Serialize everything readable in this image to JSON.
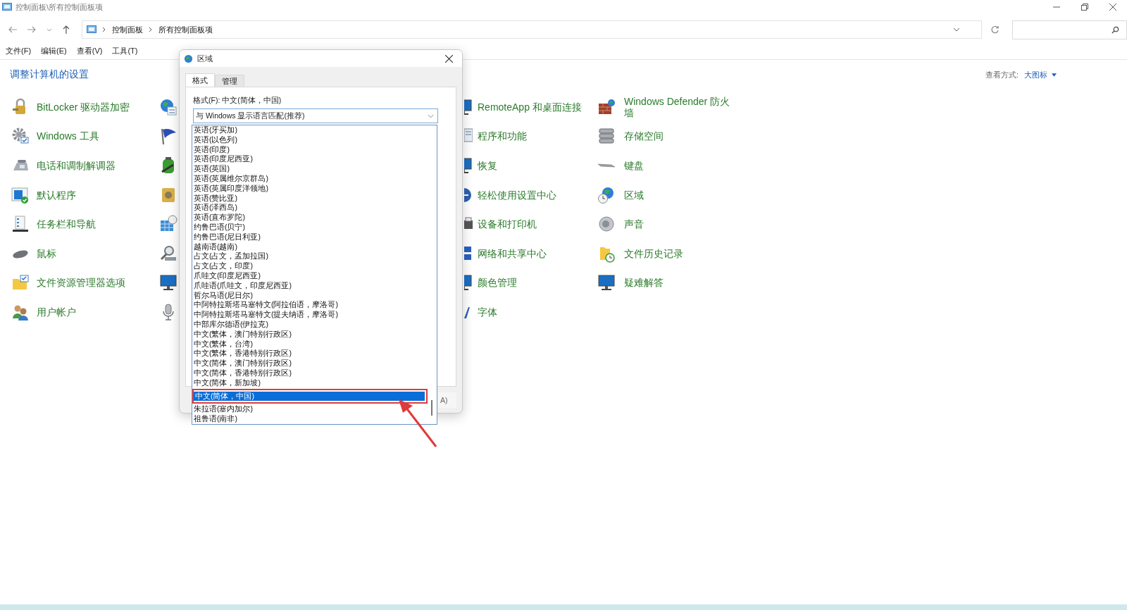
{
  "window": {
    "title": "控制面板\\所有控制面板项"
  },
  "address_bar": {
    "breadcrumbs": [
      "控制面板",
      "所有控制面板项"
    ]
  },
  "menu": [
    "文件(F)",
    "编辑(E)",
    "查看(V)",
    "工具(T)"
  ],
  "heading": "调整计算机的设置",
  "view_by": {
    "label": "查看方式:",
    "value": "大图标"
  },
  "grid": [
    {
      "cells": [
        {
          "kind": "labeled",
          "label": "BitLocker 驱动器加密"
        },
        {
          "kind": "covered"
        },
        {
          "kind": "labeled",
          "label": "RemoteApp 和桌面连接"
        },
        {
          "kind": "labeled",
          "label": "Windows Defender 防火墙"
        }
      ]
    },
    {
      "cells": [
        {
          "kind": "labeled",
          "label": "Windows 工具"
        },
        {
          "kind": "covered"
        },
        {
          "kind": "labeled",
          "label": "程序和功能"
        },
        {
          "kind": "labeled",
          "label": "存储空间"
        }
      ]
    },
    {
      "cells": [
        {
          "kind": "labeled",
          "label": "电话和调制解调器"
        },
        {
          "kind": "covered"
        },
        {
          "kind": "labeled",
          "label": "恢复"
        },
        {
          "kind": "labeled",
          "label": "键盘"
        }
      ]
    },
    {
      "cells": [
        {
          "kind": "labeled",
          "label": "默认程序"
        },
        {
          "kind": "covered"
        },
        {
          "kind": "labeled",
          "label": "轻松使用设置中心"
        },
        {
          "kind": "labeled",
          "label": "区域"
        }
      ]
    },
    {
      "cells": [
        {
          "kind": "labeled",
          "label": "任务栏和导航"
        },
        {
          "kind": "covered"
        },
        {
          "kind": "labeled",
          "label": "设备和打印机"
        },
        {
          "kind": "labeled",
          "label": "声音"
        }
      ]
    },
    {
      "cells": [
        {
          "kind": "labeled",
          "label": "鼠标"
        },
        {
          "kind": "covered"
        },
        {
          "kind": "labeled",
          "label": "网络和共享中心"
        },
        {
          "kind": "labeled",
          "label": "文件历史记录"
        }
      ]
    },
    {
      "cells": [
        {
          "kind": "labeled",
          "label": "文件资源管理器选项"
        },
        {
          "kind": "covered"
        },
        {
          "kind": "labeled",
          "label": "颜色管理"
        },
        {
          "kind": "labeled",
          "label": "疑难解答"
        }
      ]
    },
    {
      "cells": [
        {
          "kind": "labeled",
          "label": "用户帐户"
        },
        {
          "kind": "covered"
        },
        {
          "kind": "labeled",
          "label": "字体"
        }
      ]
    }
  ],
  "dialog": {
    "title": "区域",
    "tabs": [
      {
        "label": "格式",
        "selected": true
      },
      {
        "label": "管理",
        "selected": false
      }
    ],
    "format_label": "格式(F): 中文(简体，中国)",
    "format_value": "与 Windows 显示语言匹配(推荐)",
    "button_fragment": "A)",
    "options": [
      {
        "label": "英语(牙买加)",
        "selected": false
      },
      {
        "label": "英语(以色列)",
        "selected": false
      },
      {
        "label": "英语(印度)",
        "selected": false
      },
      {
        "label": "英语(印度尼西亚)",
        "selected": false
      },
      {
        "label": "英语(英国)",
        "selected": false
      },
      {
        "label": "英语(英属维尔京群岛)",
        "selected": false
      },
      {
        "label": "英语(英属印度洋领地)",
        "selected": false
      },
      {
        "label": "英语(赞比亚)",
        "selected": false
      },
      {
        "label": "英语(泽西岛)",
        "selected": false
      },
      {
        "label": "英语(直布罗陀)",
        "selected": false
      },
      {
        "label": "约鲁巴语(贝宁)",
        "selected": false
      },
      {
        "label": "约鲁巴语(尼日利亚)",
        "selected": false
      },
      {
        "label": "越南语(越南)",
        "selected": false
      },
      {
        "label": "占文(占文，孟加拉国)",
        "selected": false
      },
      {
        "label": "占文(占文，印度)",
        "selected": false
      },
      {
        "label": "爪哇文(印度尼西亚)",
        "selected": false
      },
      {
        "label": "爪哇语(爪哇文，印度尼西亚)",
        "selected": false
      },
      {
        "label": "哲尔马语(尼日尔)",
        "selected": false
      },
      {
        "label": "中阿特拉斯塔马塞特文(阿拉伯语，摩洛哥)",
        "selected": false
      },
      {
        "label": "中阿特拉斯塔马塞特文(提夫纳语，摩洛哥)",
        "selected": false
      },
      {
        "label": "中部库尔德语(伊拉克)",
        "selected": false
      },
      {
        "label": "中文(繁体，澳门特别行政区)",
        "selected": false
      },
      {
        "label": "中文(繁体，台湾)",
        "selected": false
      },
      {
        "label": "中文(繁体，香港特别行政区)",
        "selected": false
      },
      {
        "label": "中文(简体，澳门特别行政区)",
        "selected": false
      },
      {
        "label": "中文(简体，香港特别行政区)",
        "selected": false
      },
      {
        "label": "中文(简体，新加坡)",
        "selected": false
      },
      {
        "label": "中文(简体，中国)",
        "selected": true
      },
      {
        "label": "朱拉语(塞内加尔)",
        "selected": false
      },
      {
        "label": "祖鲁语(南非)",
        "selected": false
      }
    ]
  }
}
